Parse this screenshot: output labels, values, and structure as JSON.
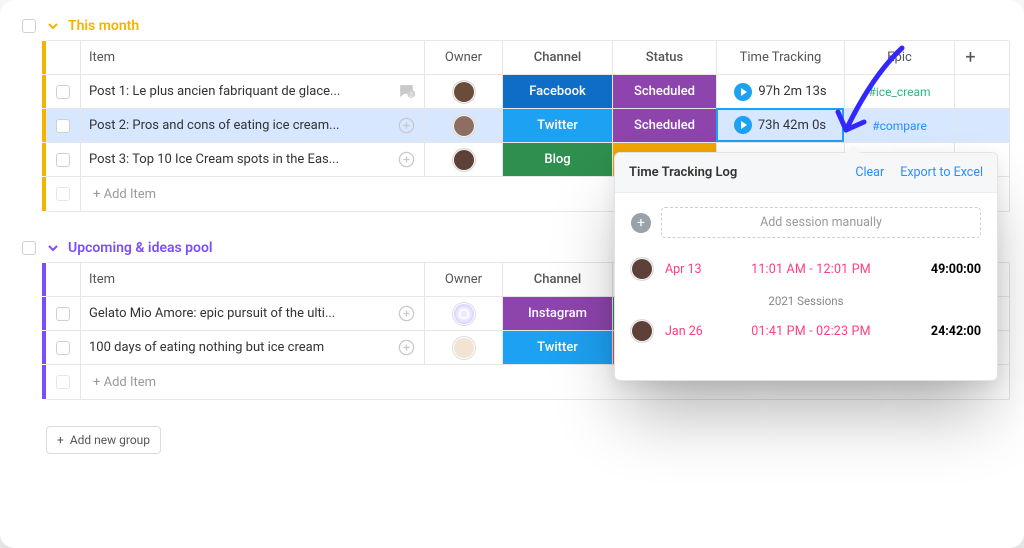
{
  "groups": {
    "g1": {
      "title": "This month"
    },
    "g2": {
      "title": "Upcoming & ideas pool"
    }
  },
  "headers": {
    "item": "Item",
    "owner": "Owner",
    "channel": "Channel",
    "status": "Status",
    "time": "Time Tracking",
    "epic": "Epic"
  },
  "g1rows": {
    "r1": {
      "item": "Post 1: Le plus ancien fabriquant de glace...",
      "channel": "Facebook",
      "status": "Scheduled",
      "time": "97h 2m 13s",
      "epic": "#ice_cream"
    },
    "r2": {
      "item": "Post 2: Pros and cons of eating ice cream...",
      "channel": "Twitter",
      "status": "Scheduled",
      "time": "73h 42m 0s",
      "epic": "#compare"
    },
    "r3": {
      "item": "Post 3: Top 10 Ice Cream spots in the Eas...",
      "channel": "Blog"
    }
  },
  "g2rows": {
    "r1": {
      "item": "Gelato Mio Amore: epic pursuit of the ulti...",
      "channel": "Instagram"
    },
    "r2": {
      "item": "100 days of eating nothing but ice cream",
      "channel": "Twitter"
    }
  },
  "addItem": "+ Add Item",
  "addGroup": "Add new group",
  "popover": {
    "title": "Time Tracking Log",
    "clear": "Clear",
    "export": "Export to Excel",
    "addManual": "Add session manually",
    "s1": {
      "date": "Apr 13",
      "times": "11:01 AM - 12:01 PM",
      "dur": "49:00:00"
    },
    "yearSep": "2021 Sessions",
    "s2": {
      "date": "Jan 26",
      "times": "01:41 PM - 02:23 PM",
      "dur": "24:42:00"
    }
  }
}
